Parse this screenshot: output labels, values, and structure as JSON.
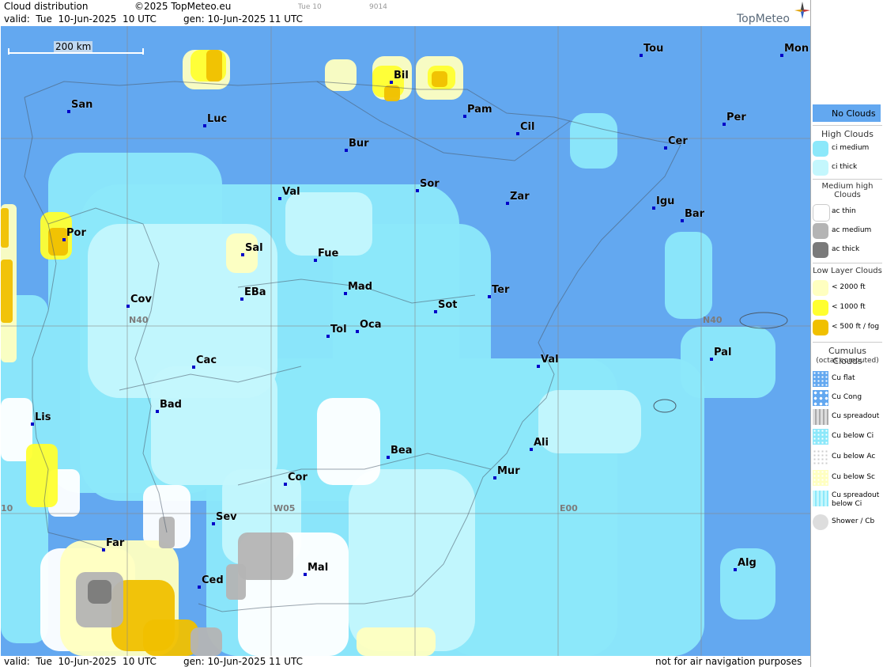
{
  "header": {
    "title": "Cloud distribution",
    "copyright": "©2025 TopMeteo.eu",
    "day_small": "Tue 10",
    "code_small": "9014",
    "valid": "valid:  Tue  10-Jun-2025  10 UTC",
    "gen": "gen: 10-Jun-2025 11 UTC",
    "logo": "TopMeteo"
  },
  "footer": {
    "valid": "valid:  Tue  10-Jun-2025  10 UTC",
    "gen": "gen: 10-Jun-2025 11 UTC",
    "disclaimer": "not for air navigation purposes"
  },
  "map": {
    "scale": "200 km",
    "grid_labels": {
      "n40_left": "N40",
      "n40_right": "N40",
      "w05": "W05",
      "e00": "E00",
      "edge": "10"
    },
    "cities": [
      {
        "name": "Tou"
      },
      {
        "name": "Mon"
      },
      {
        "name": "Bil"
      },
      {
        "name": "San"
      },
      {
        "name": "Luc"
      },
      {
        "name": "Pam"
      },
      {
        "name": "Cil"
      },
      {
        "name": "Per"
      },
      {
        "name": "Bur"
      },
      {
        "name": "Cer"
      },
      {
        "name": "Sor"
      },
      {
        "name": "Val"
      },
      {
        "name": "Zar"
      },
      {
        "name": "Igu"
      },
      {
        "name": "Bar"
      },
      {
        "name": "Por"
      },
      {
        "name": "Sal"
      },
      {
        "name": "Fue"
      },
      {
        "name": "Mad"
      },
      {
        "name": "Ter"
      },
      {
        "name": "Cov"
      },
      {
        "name": "EBa"
      },
      {
        "name": "Sot"
      },
      {
        "name": "Tol"
      },
      {
        "name": "Oca"
      },
      {
        "name": "Cac"
      },
      {
        "name": "Val"
      },
      {
        "name": "Pal"
      },
      {
        "name": "Bad"
      },
      {
        "name": "Lis"
      },
      {
        "name": "Ali"
      },
      {
        "name": "Bea"
      },
      {
        "name": "Mur"
      },
      {
        "name": "Cor"
      },
      {
        "name": "Sev"
      },
      {
        "name": "Far"
      },
      {
        "name": "Mal"
      },
      {
        "name": "Alg"
      },
      {
        "name": "Ced"
      }
    ],
    "colors": {
      "no_clouds": "#63a8f0",
      "ci_medium": "#8ce8fa",
      "ci_thick": "#c4f7fd",
      "low_2000": "#ffffc0",
      "low_1000": "#ffff30",
      "low_500": "#f0c000",
      "ac_thin": "#ffffff",
      "ac_medium": "#b4b4b4",
      "ac_thick": "#7a7a7a"
    }
  },
  "legend": {
    "no_clouds": "No Clouds",
    "high_title": "High Clouds",
    "ci_medium": "ci medium",
    "ci_thick": "ci thick",
    "medium_title": "Medium high Clouds",
    "ac_thin": "ac thin",
    "ac_medium": "ac medium",
    "ac_thick": "ac thick",
    "low_title": "Low Layer Clouds",
    "low_2000": "< 2000 ft",
    "low_1000": "< 1000 ft",
    "low_500": "< 500 ft / fog",
    "cu_title": "Cumulus Clouds",
    "cu_subtitle": "(octas computed)",
    "cu_flat": "Cu flat",
    "cu_cong": "Cu Cong",
    "cu_spreadout": "Cu spreadout",
    "cu_below_ci": "Cu below Ci",
    "cu_below_ac": "Cu below Ac",
    "cu_below_sc": "Cu below Sc",
    "cu_spreadout_below_ci_1": "Cu spreadout",
    "cu_spreadout_below_ci_2": "below Ci",
    "shower": "Shower / Cb"
  }
}
